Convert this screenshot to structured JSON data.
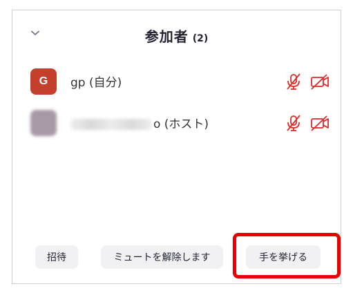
{
  "header": {
    "title": "参加者",
    "count": "(2)"
  },
  "participants": [
    {
      "avatar_letter": "G",
      "name": "gp (自分)",
      "avatar_color": "#c5402c"
    },
    {
      "avatar_letter": "",
      "name_suffix": "o (ホスト)",
      "avatar_color": "#a899a6"
    }
  ],
  "footer": {
    "invite_label": "招待",
    "unmute_all_label": "ミュートを解除します",
    "raise_hand_label": "手を挙げる"
  },
  "icons": {
    "collapse": "chevron-down-icon",
    "mic": "mic-muted-icon",
    "camera": "camera-off-icon"
  },
  "colors": {
    "muted_icon": "#e02828",
    "highlight": "#ea0000",
    "button_bg": "#f1f1f4"
  }
}
